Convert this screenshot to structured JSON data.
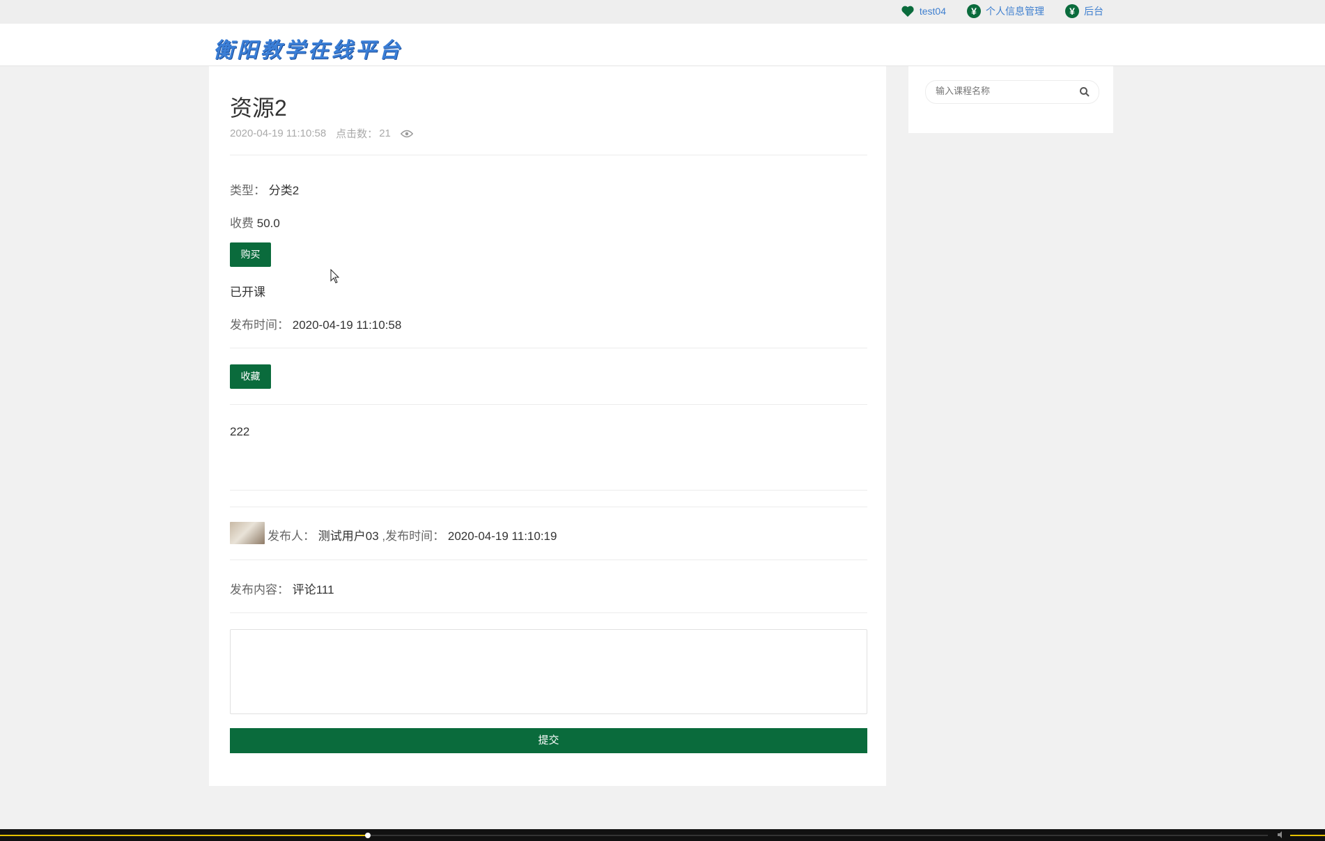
{
  "topbar": {
    "links": [
      {
        "label": "test04",
        "icon": "heart-icon"
      },
      {
        "label": "个人信息管理",
        "icon": "yen-icon"
      },
      {
        "label": "后台",
        "icon": "yen-icon"
      }
    ],
    "yen_glyph": "¥"
  },
  "header": {
    "logo": "衡阳教学在线平台"
  },
  "resource": {
    "title": "资源2",
    "date": "2020-04-19 11:10:58",
    "clicks_label": "点击数：",
    "clicks": "21",
    "type_label": "类型：",
    "type_value": "分类2",
    "fee_label": "收费",
    "fee_value": "50.0",
    "buy_label": "购买",
    "status": "已开课",
    "publish_label": "发布时间：",
    "publish_value": "2020-04-19 11:10:58",
    "favorite_label": "收藏",
    "content": "222"
  },
  "comment": {
    "author_label": "发布人：",
    "author": "测试用户03",
    "time_label": ",发布时间：",
    "time": "2020-04-19 11:10:19",
    "content_label": "发布内容：",
    "content": "评论111"
  },
  "form": {
    "submit_label": "提交"
  },
  "search": {
    "placeholder": "输入课程名称"
  },
  "colors": {
    "primary": "#0a6b3c",
    "link": "#3e7fcf",
    "progress": "#e6c200"
  },
  "player": {
    "progress": 0.29
  }
}
